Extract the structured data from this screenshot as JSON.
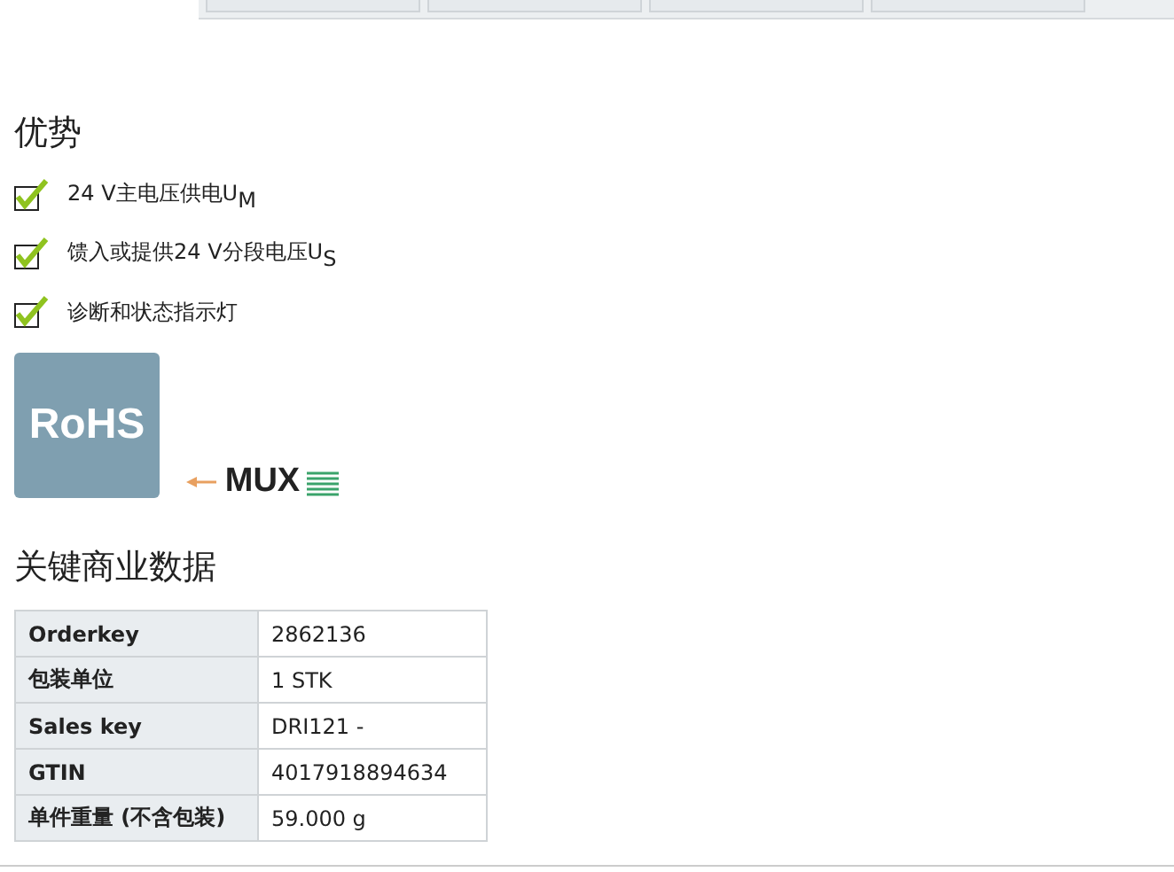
{
  "top_tabs": [
    {
      "kind": "tab"
    },
    {
      "kind": "tab"
    },
    {
      "kind": "tab"
    },
    {
      "kind": "tab"
    }
  ],
  "advantages": {
    "title": "优势",
    "items": [
      {
        "text": "24 V主电压供电U$_{M}$",
        "checked": true
      },
      {
        "text": "馈入或提供24 V分段电压U$_{S}$",
        "checked": true
      },
      {
        "text": "诊断和状态指示灯",
        "checked": true
      }
    ]
  },
  "logos": [
    {
      "kind": "rohs",
      "text": "RoHS"
    },
    {
      "kind": "mux",
      "text": "MUX"
    }
  ],
  "commercial_data": {
    "title": "关键商业数据",
    "rows": [
      {
        "label": "Orderkey",
        "value": "2862136"
      },
      {
        "label": "包装单位",
        "value": "1 STK"
      },
      {
        "label": "Sales key",
        "value": "DRI121 -"
      },
      {
        "label": "GTIN",
        "value": "4017918894634"
      },
      {
        "label": "单件重量 (不含包装)",
        "value": "59.000 g"
      }
    ]
  }
}
